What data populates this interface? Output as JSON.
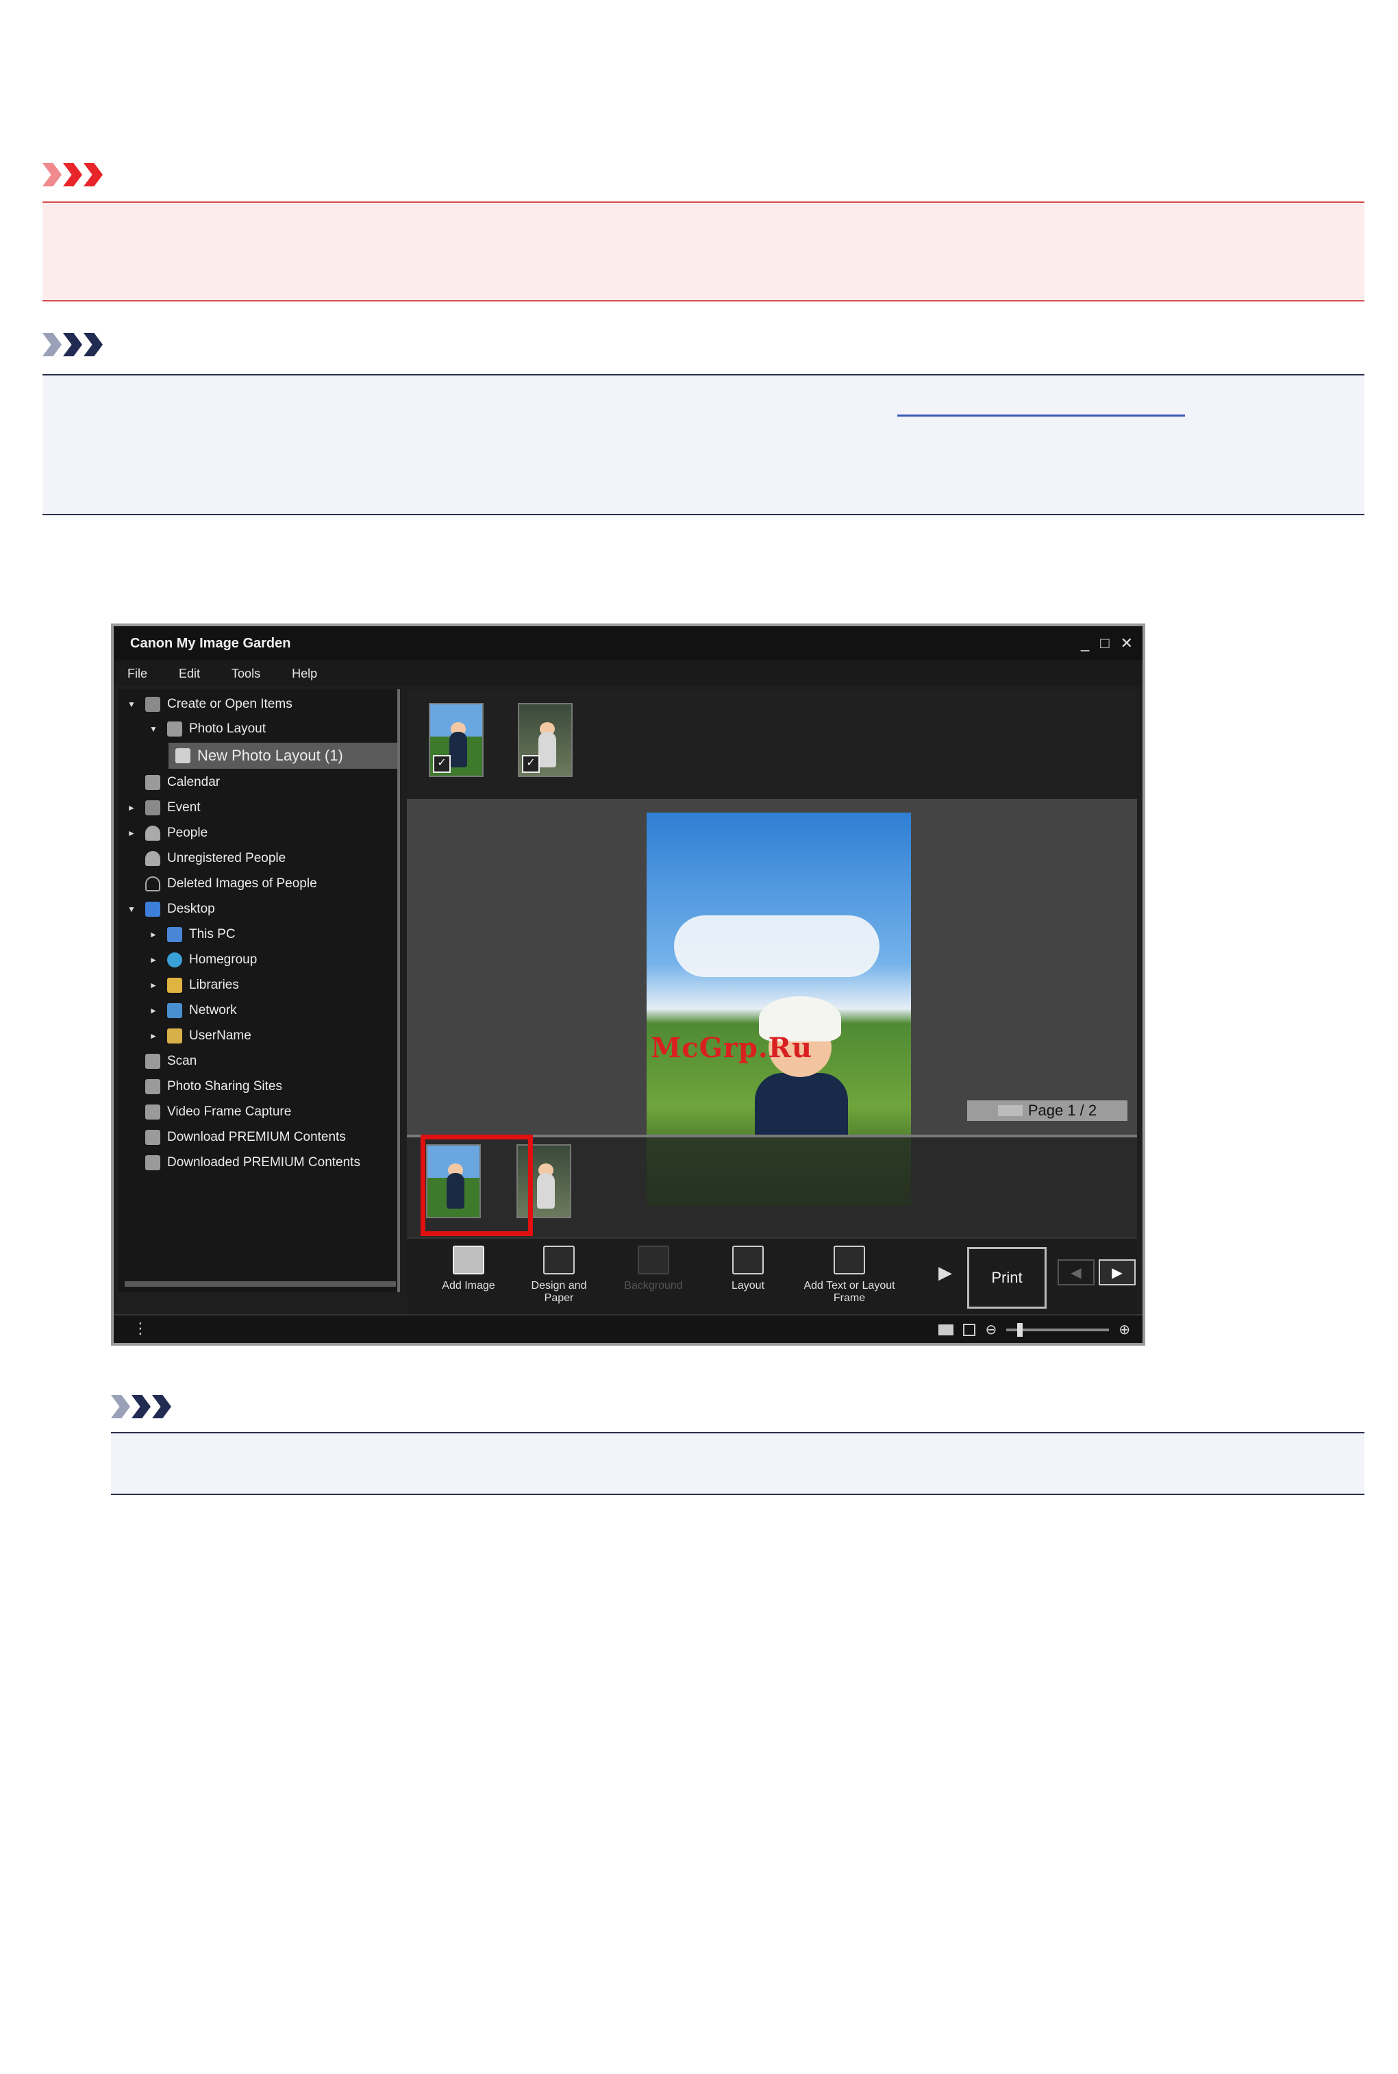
{
  "app": {
    "title": "Canon My Image Garden",
    "window_controls": {
      "minimize": "_",
      "maximize": "□",
      "close": "✕"
    },
    "menu": [
      "File",
      "Edit",
      "Tools",
      "Help"
    ],
    "tree": [
      {
        "label": "Create or Open Items",
        "arrow": "▼",
        "icon": "create-items-icon"
      },
      {
        "label": "Photo Layout",
        "arrow": "▼",
        "icon": "photo-layout-icon"
      },
      {
        "label": "New Photo Layout (1)",
        "icon": "layout-icon",
        "selected": true
      },
      {
        "label": "Calendar",
        "icon": "calendar-icon"
      },
      {
        "label": "Event",
        "arrow": "►",
        "icon": "event-icon"
      },
      {
        "label": "People",
        "arrow": "►",
        "icon": "people-icon"
      },
      {
        "label": "Unregistered People",
        "icon": "unregistered-people-icon"
      },
      {
        "label": "Deleted Images of People",
        "icon": "deleted-people-icon"
      },
      {
        "label": "Desktop",
        "arrow": "▼",
        "icon": "desktop-icon"
      },
      {
        "label": "This PC",
        "arrow": "►",
        "icon": "pc-icon"
      },
      {
        "label": "Homegroup",
        "arrow": "►",
        "icon": "homegroup-icon"
      },
      {
        "label": "Libraries",
        "arrow": "►",
        "icon": "libraries-icon"
      },
      {
        "label": "Network",
        "arrow": "►",
        "icon": "network-icon"
      },
      {
        "label": "UserName",
        "arrow": "►",
        "icon": "user-folder-icon"
      },
      {
        "label": "Scan",
        "icon": "scan-icon"
      },
      {
        "label": "Photo Sharing Sites",
        "icon": "photo-sharing-icon"
      },
      {
        "label": "Video Frame Capture",
        "icon": "video-frame-icon"
      },
      {
        "label": "Download PREMIUM Contents",
        "icon": "download-premium-icon"
      },
      {
        "label": "Downloaded PREMIUM Contents",
        "icon": "downloaded-premium-icon"
      }
    ],
    "watermark": "McGrp.Ru",
    "page_indicator": "Page 1 / 2",
    "tools": {
      "add_image": "Add Image",
      "design_and_paper": "Design and Paper",
      "background": "Background",
      "layout": "Layout",
      "add_text": "Add Text or Layout Frame"
    },
    "print_label": "Print",
    "next_arrow": "▶",
    "nav": {
      "prev": "◀",
      "next": "▶"
    },
    "status_menu": "⋮",
    "zoom": {
      "out": "⊖",
      "in": "⊕"
    }
  },
  "colors": {
    "important_accent": "#e8252a",
    "note_accent": "#222b52",
    "highlight_box": "#e01010"
  }
}
